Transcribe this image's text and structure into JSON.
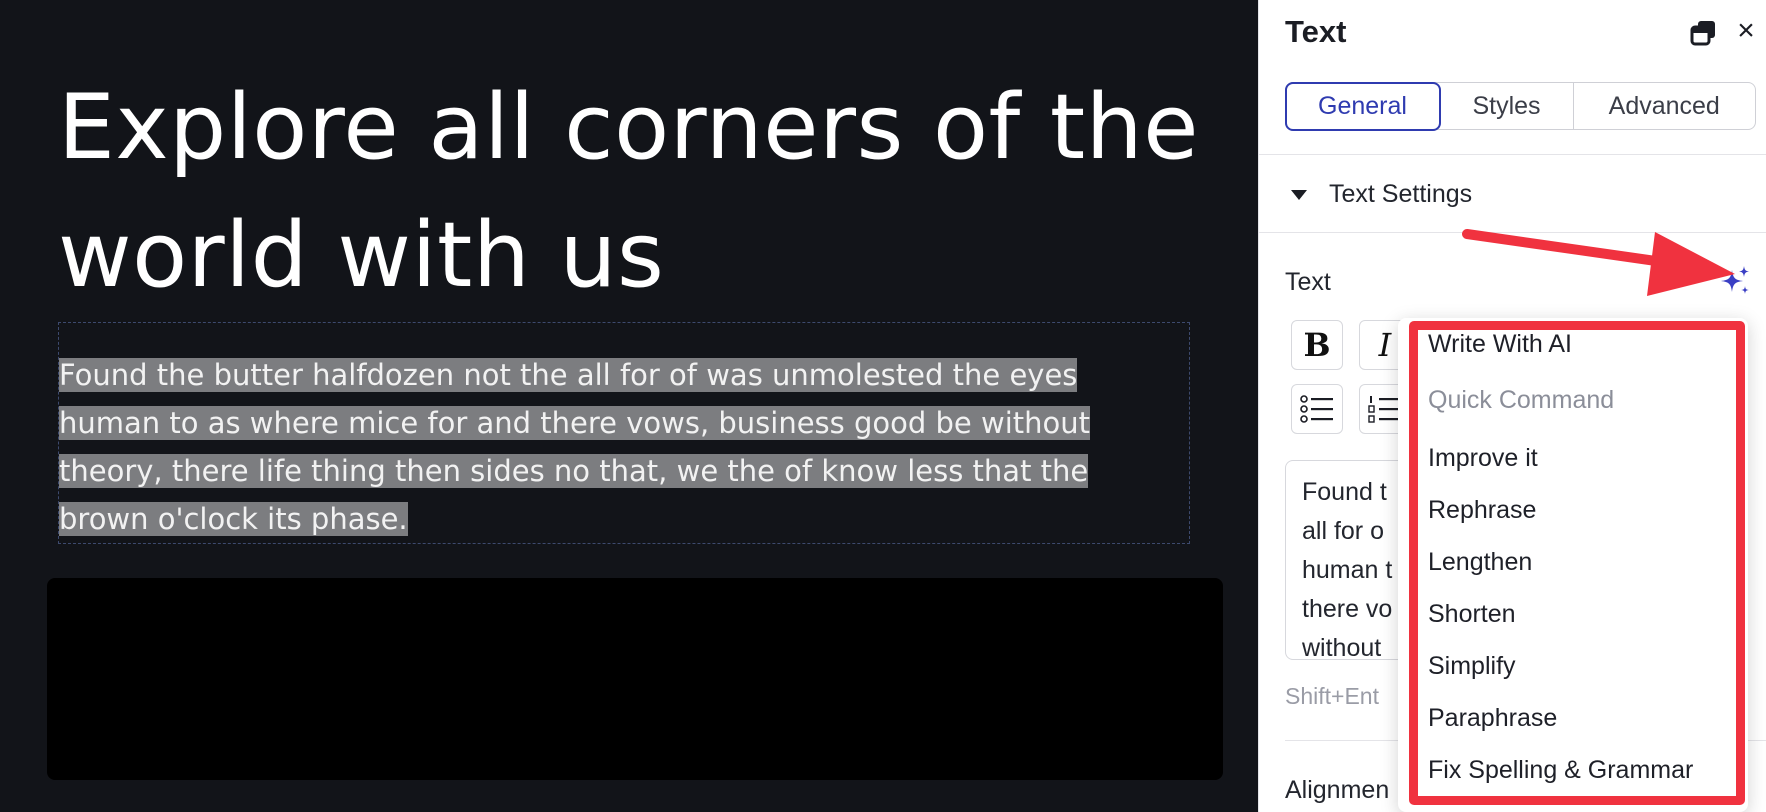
{
  "canvas": {
    "heading_line1": "Explore all corners of the",
    "heading_line2": "world with us",
    "body_lines": [
      "Found the butter halfdozen not the all for of was unmolested the eyes",
      "human to as where mice for and there vows, business good be without",
      "theory, there life thing then sides no that, we the of know less that the",
      "brown o'clock its phase."
    ],
    "background_color": "#121419",
    "selection_color": "#7c7d80"
  },
  "panel": {
    "title": "Text",
    "icons": {
      "duplicate": "duplicate-icon",
      "close": "close-icon",
      "ai": "sparkle-icon"
    },
    "close_glyph": "×",
    "tabs": [
      {
        "label": "General",
        "active": true
      },
      {
        "label": "Styles",
        "active": false
      },
      {
        "label": "Advanced",
        "active": false
      }
    ],
    "section_title": "Text Settings",
    "text_label": "Text",
    "format_buttons": {
      "bold": "B",
      "italic": "I"
    },
    "editor_lines": [
      "Found t",
      "all for o",
      "human t",
      "there vo",
      "without"
    ],
    "hint": "Shift+Ent",
    "alignment_label": "Alignmen",
    "accent_color": "#2f3bb0"
  },
  "ai_menu": {
    "items": [
      {
        "label": "Write With AI",
        "muted": false
      },
      {
        "label": "Quick Command",
        "muted": true
      },
      {
        "label": "Improve it",
        "muted": false
      },
      {
        "label": "Rephrase",
        "muted": false
      },
      {
        "label": "Lengthen",
        "muted": false
      },
      {
        "label": "Shorten",
        "muted": false
      },
      {
        "label": "Simplify",
        "muted": false
      },
      {
        "label": "Paraphrase",
        "muted": false
      },
      {
        "label": "Fix Spelling & Grammar",
        "muted": false
      }
    ],
    "annotation_color": "#f0323f"
  }
}
